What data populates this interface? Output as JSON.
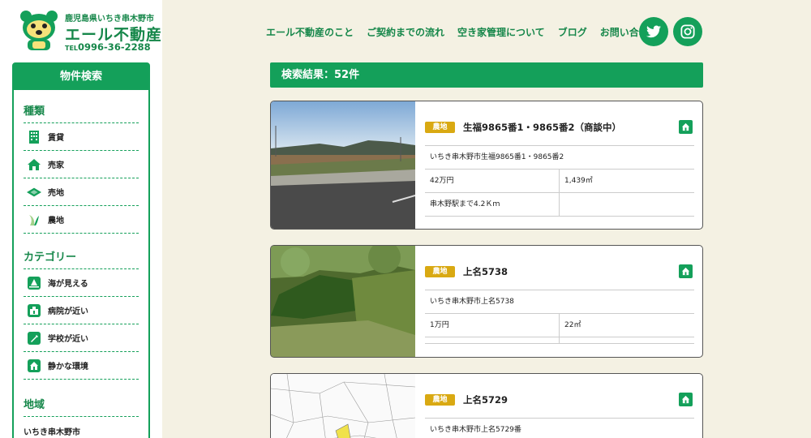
{
  "logo": {
    "small_text": "鹿児島県いちき串木野市",
    "name": "エール不動産",
    "tel_prefix": "TEL",
    "tel": "0996-36-2288"
  },
  "nav": {
    "items": [
      "エール不動産のこと",
      "ご契約までの流れ",
      "空き家管理について",
      "ブログ",
      "お問い合わせ"
    ]
  },
  "social": {
    "twitter": "twitter-icon",
    "instagram": "instagram-icon"
  },
  "sidebar": {
    "title": "物件検索",
    "types_title": "種類",
    "types": [
      {
        "label": "賃貸",
        "icon": "building-icon"
      },
      {
        "label": "売家",
        "icon": "house-icon"
      },
      {
        "label": "売地",
        "icon": "land-icon"
      },
      {
        "label": "農地",
        "icon": "farm-icon"
      }
    ],
    "category_title": "カテゴリー",
    "categories": [
      {
        "label": "海が見える",
        "icon": "sea-view-icon"
      },
      {
        "label": "病院が近い",
        "icon": "hospital-icon"
      },
      {
        "label": "学校が近い",
        "icon": "school-icon"
      },
      {
        "label": "静かな環境",
        "icon": "quiet-icon"
      }
    ],
    "area_title": "地域",
    "areas": [
      "いちき串木野市"
    ]
  },
  "results": {
    "label": "検索結果：52件"
  },
  "listings": [
    {
      "tag": "農地",
      "title": "生福9865番1・9865番2（商談中）",
      "address": "いちき串木野市生福9865番1・9865番2",
      "price": "42万円",
      "area": "1,439㎡",
      "access": "串木野駅まで4.2Ｋｍ"
    },
    {
      "tag": "農地",
      "title": "上名5738",
      "address": "いちき串木野市上名5738",
      "price": "1万円",
      "area": "22㎡"
    },
    {
      "tag": "農地",
      "title": "上名5729",
      "address": "いちき串木野市上名5729番"
    }
  ],
  "colors": {
    "brand_green": "#14a05a",
    "tag_gold": "#d9a912",
    "background": "#f4f1e3"
  }
}
